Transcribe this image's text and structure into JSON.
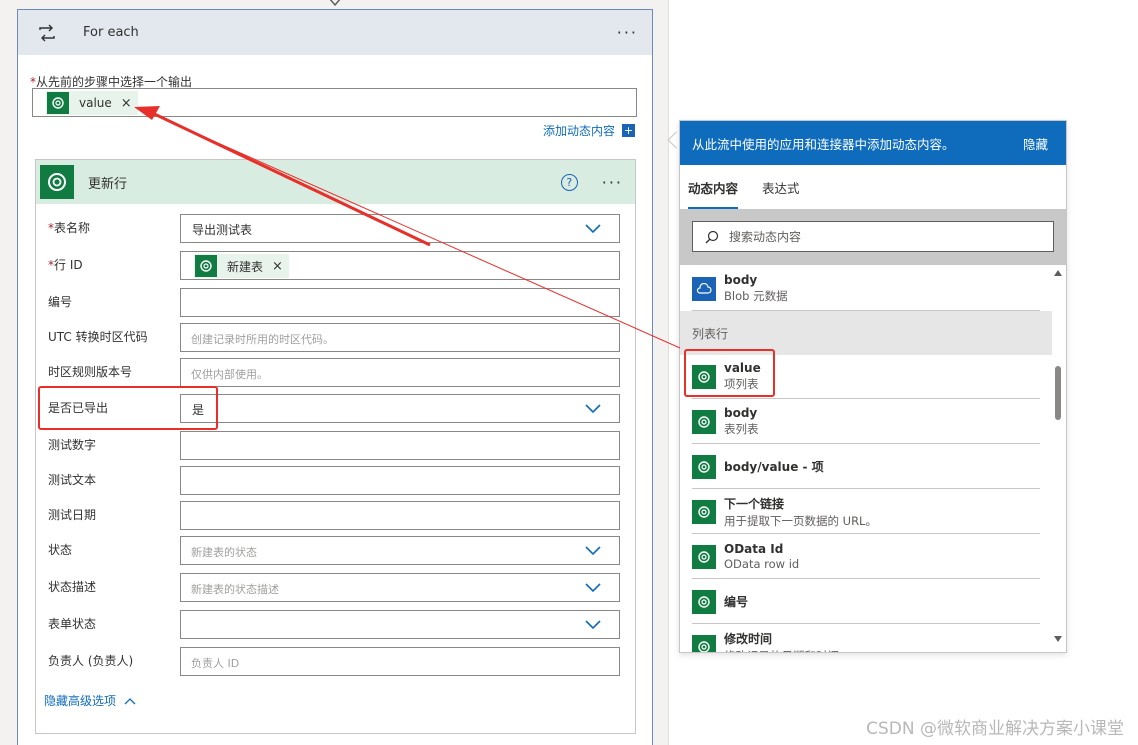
{
  "foreach": {
    "title": "For each",
    "output_label": "从先前的步骤中选择一个输出",
    "token_value": "value",
    "token_close": "×",
    "add_dynamic": "添加动态内容",
    "add_icon": "+"
  },
  "update_row": {
    "title": "更新行",
    "help": "?",
    "more": "···",
    "fields": [
      {
        "label": "表名称",
        "required": "*",
        "value": "导出测试表",
        "placeholder": ""
      },
      {
        "label": "行 ID",
        "required": "*",
        "value": "新建表",
        "placeholder": ""
      },
      {
        "label": "编号",
        "required": "",
        "value": "",
        "placeholder": ""
      },
      {
        "label": "UTC 转换时区代码",
        "required": "",
        "value": "",
        "placeholder": "创建记录时所用的时区代码。"
      },
      {
        "label": "时区规则版本号",
        "required": "",
        "value": "",
        "placeholder": "仅供内部使用。"
      },
      {
        "label": "是否已导出",
        "required": "",
        "value": "是",
        "placeholder": ""
      },
      {
        "label": "测试数字",
        "required": "",
        "value": "",
        "placeholder": ""
      },
      {
        "label": "测试文本",
        "required": "",
        "value": "",
        "placeholder": ""
      },
      {
        "label": "测试日期",
        "required": "",
        "value": "",
        "placeholder": ""
      },
      {
        "label": "状态",
        "required": "",
        "value": "",
        "placeholder": "新建表的状态"
      },
      {
        "label": "状态描述",
        "required": "",
        "value": "",
        "placeholder": "新建表的状态描述"
      },
      {
        "label": "表单状态",
        "required": "",
        "value": "",
        "placeholder": ""
      },
      {
        "label": "负责人 (负责人)",
        "required": "",
        "value": "",
        "placeholder": "负责人 ID"
      }
    ],
    "hide_advanced": "隐藏高级选项"
  },
  "dynamic_panel": {
    "header": "从此流中使用的应用和连接器中添加动态内容。",
    "hide": "隐藏",
    "tabs": [
      "动态内容",
      "表达式"
    ],
    "search_placeholder": "搜索动态内容",
    "section": "列表行",
    "items": [
      {
        "title": "body",
        "subtitle": "Blob 元数据"
      },
      {
        "title": "value",
        "subtitle": "项列表"
      },
      {
        "title": "body",
        "subtitle": "表列表"
      },
      {
        "title": "body/value - 项",
        "subtitle": ""
      },
      {
        "title": "下一个链接",
        "subtitle": "用于提取下一页数据的 URL。"
      },
      {
        "title": "OData Id",
        "subtitle": "OData row id"
      },
      {
        "title": "编号",
        "subtitle": ""
      },
      {
        "title": "修改时间",
        "subtitle": "修改记录的日期和时间"
      }
    ]
  },
  "watermark": "CSDN @微软商业解决方案小课堂",
  "colors": {
    "accent": "#0f6cbd",
    "dataverse_green": "#107c41",
    "highlight_red": "#e8302b"
  }
}
